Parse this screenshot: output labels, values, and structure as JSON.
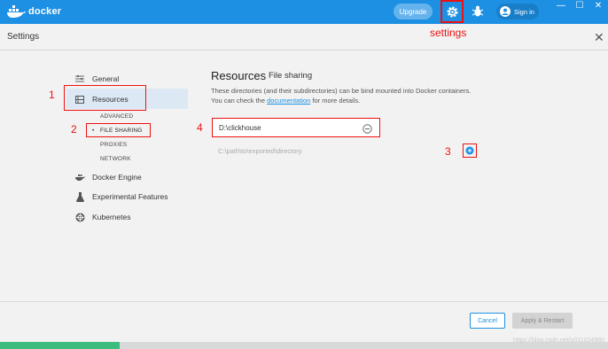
{
  "titlebar": {
    "logo_text": "docker",
    "upgrade_label": "Upgrade",
    "signin_label": "Sign in",
    "minimize": "—",
    "maximize": "☐",
    "close": "✕",
    "accent_color": "#1d90e4"
  },
  "settings": {
    "title": "Settings",
    "close_glyph": "✕",
    "annotation": "settings"
  },
  "sidebar": {
    "items": [
      {
        "label": "General",
        "icon": "sliders-icon"
      },
      {
        "label": "Resources",
        "icon": "resources-icon"
      },
      {
        "label": "Docker Engine",
        "icon": "whale-icon"
      },
      {
        "label": "Experimental Features",
        "icon": "flask-icon"
      },
      {
        "label": "Kubernetes",
        "icon": "helm-icon"
      }
    ],
    "resources_sub": [
      "ADVANCED",
      "FILE SHARING",
      "PROXIES",
      "NETWORK"
    ]
  },
  "annotations": [
    "1",
    "2",
    "3",
    "4"
  ],
  "main": {
    "title": "Resources",
    "subtitle": "File sharing",
    "desc_prefix": "These directories (and their subdirectories) can be bind mounted into Docker containers. You can check the ",
    "desc_link": "documentation",
    "desc_suffix": " for more details.",
    "shared_dir": "D:\\clickhouse",
    "new_path_placeholder": "C:\\path\\to\\exported\\directory"
  },
  "footer": {
    "cancel_label": "Cancel",
    "apply_label": "Apply & Restart",
    "watermark": "https://blog.csdn.net/u011024980"
  }
}
